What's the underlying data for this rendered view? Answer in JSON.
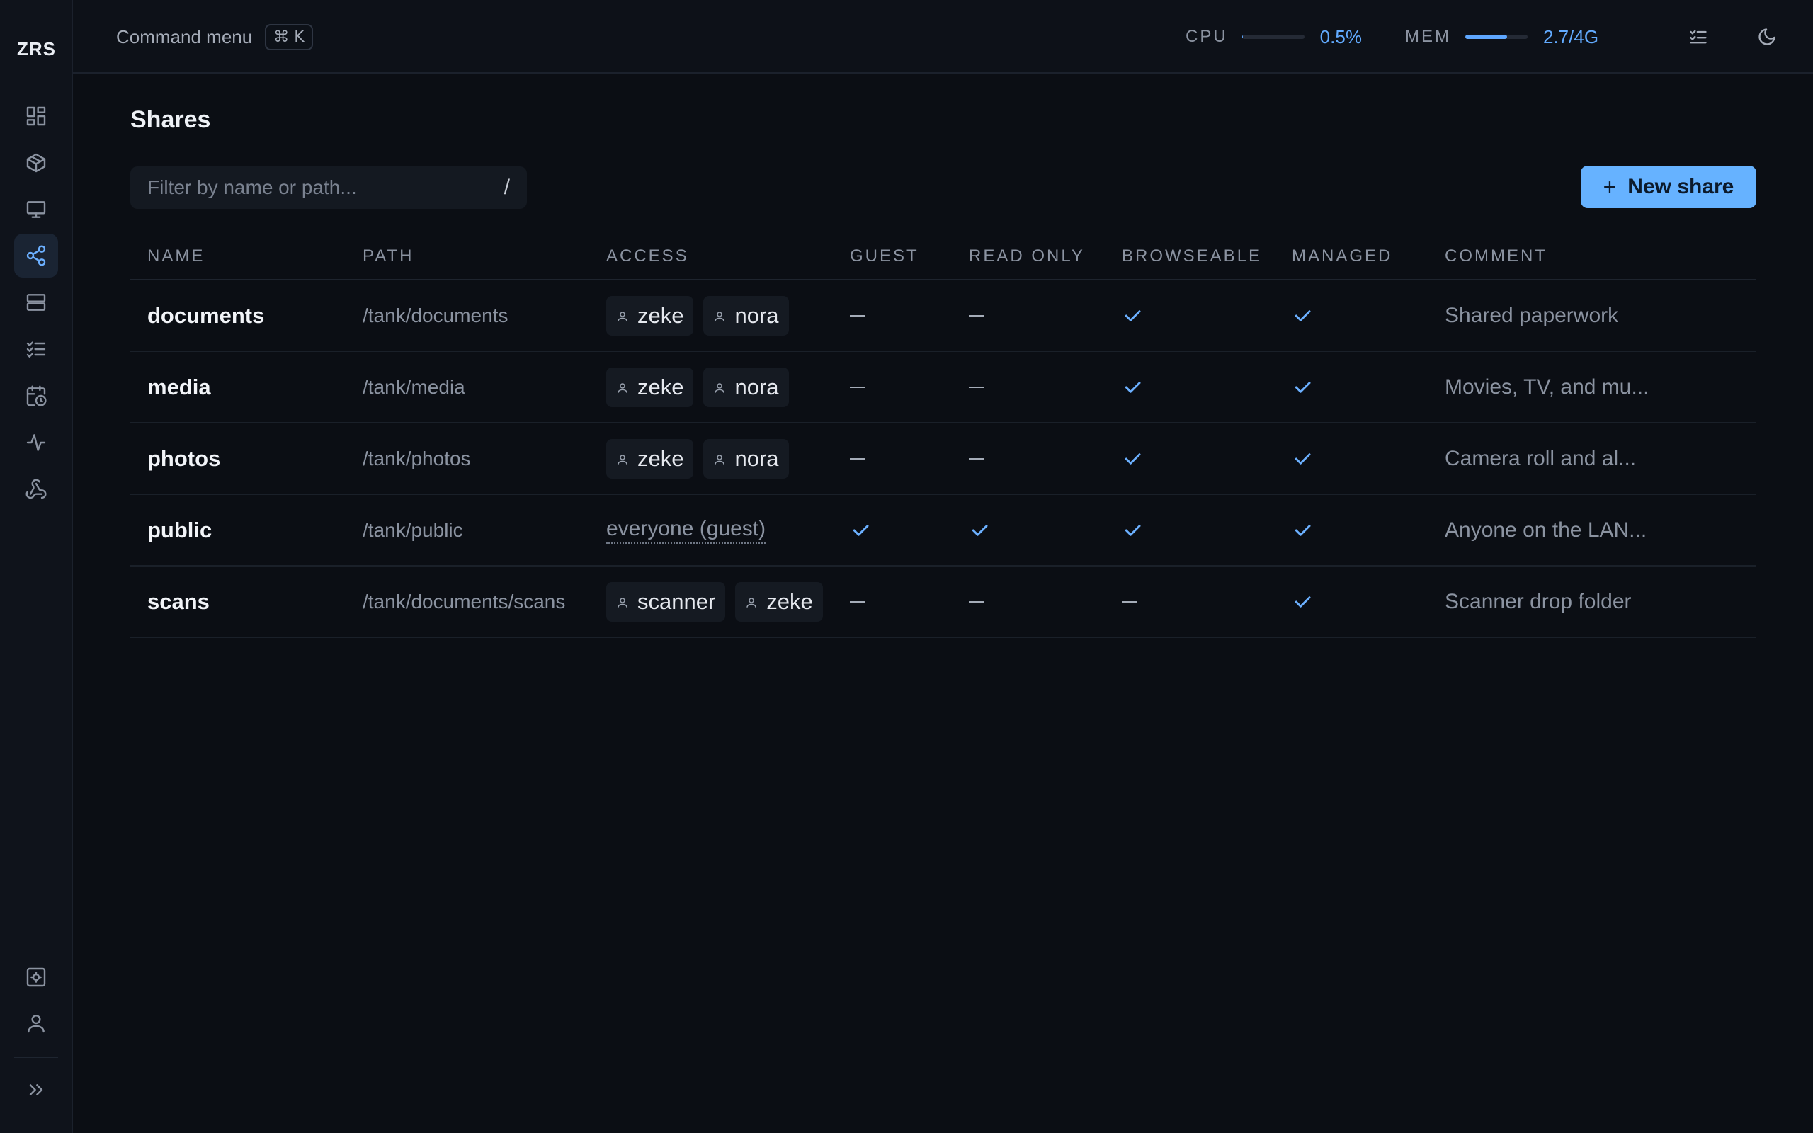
{
  "app": {
    "logo": "ZRS"
  },
  "topbar": {
    "command_label": "Command menu",
    "command_shortcut": "⌘ K",
    "cpu": {
      "label": "CPU",
      "value": "0.5%",
      "fill": 0.005
    },
    "mem": {
      "label": "MEM",
      "value": "2.7/4G",
      "fill": 0.675
    }
  },
  "sidebar": {
    "items": [
      {
        "icon": "dashboard-icon",
        "active": false
      },
      {
        "icon": "package-icon",
        "active": false
      },
      {
        "icon": "monitor-icon",
        "active": false
      },
      {
        "icon": "share-icon",
        "active": true
      },
      {
        "icon": "server-icon",
        "active": false
      },
      {
        "icon": "tasks-icon",
        "active": false
      },
      {
        "icon": "calendar-clock-icon",
        "active": false
      },
      {
        "icon": "activity-icon",
        "active": false
      },
      {
        "icon": "webhook-icon",
        "active": false
      }
    ],
    "bottom": [
      {
        "icon": "settings-icon"
      },
      {
        "icon": "user-icon"
      },
      {
        "icon": "expand-icon"
      }
    ]
  },
  "page": {
    "title": "Shares",
    "filter_placeholder": "Filter by name or path...",
    "filter_shortcut": "/",
    "new_button": "New share"
  },
  "table": {
    "columns": [
      "NAME",
      "PATH",
      "ACCESS",
      "GUEST",
      "READ ONLY",
      "BROWSEABLE",
      "MANAGED",
      "COMMENT"
    ],
    "rows": [
      {
        "name": "documents",
        "path": "/tank/documents",
        "access": [
          "zeke",
          "nora"
        ],
        "guest": false,
        "read_only": false,
        "browseable": true,
        "managed": true,
        "comment": "Shared paperwork"
      },
      {
        "name": "media",
        "path": "/tank/media",
        "access": [
          "zeke",
          "nora"
        ],
        "guest": false,
        "read_only": false,
        "browseable": true,
        "managed": true,
        "comment": "Movies, TV, and mu..."
      },
      {
        "name": "photos",
        "path": "/tank/photos",
        "access": [
          "zeke",
          "nora"
        ],
        "guest": false,
        "read_only": false,
        "browseable": true,
        "managed": true,
        "comment": "Camera roll and al..."
      },
      {
        "name": "public",
        "path": "/tank/public",
        "access_text": "everyone (guest)",
        "access": [],
        "guest": true,
        "read_only": true,
        "browseable": true,
        "managed": true,
        "comment": "Anyone on the LAN..."
      },
      {
        "name": "scans",
        "path": "/tank/documents/scans",
        "access": [
          "scanner",
          "zeke"
        ],
        "guest": false,
        "read_only": false,
        "browseable": false,
        "managed": true,
        "comment": "Scanner drop folder"
      }
    ]
  },
  "colors": {
    "accent": "#66b2ff",
    "background": "#0b0e14",
    "sidebar": "#0f131b"
  }
}
